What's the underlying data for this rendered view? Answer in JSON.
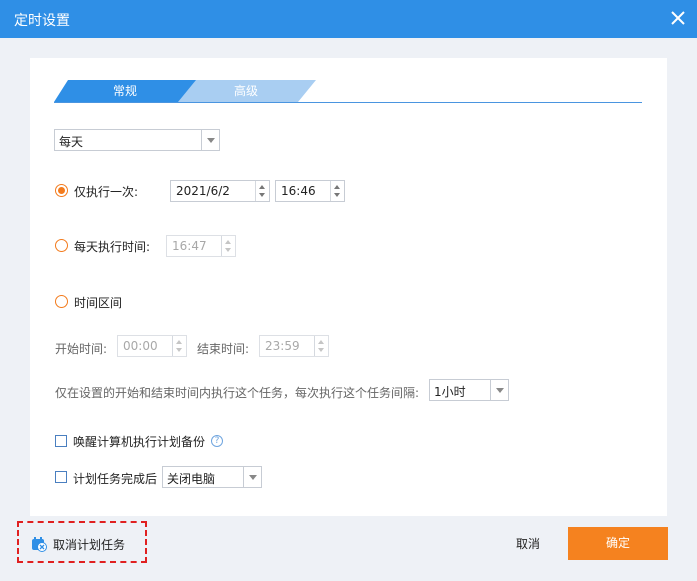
{
  "window": {
    "title": "定时设置"
  },
  "tabs": [
    {
      "label": "常规",
      "active": true
    },
    {
      "label": "高级",
      "active": false
    }
  ],
  "frequency": {
    "value": "每天"
  },
  "once": {
    "label": "仅执行一次:",
    "date": "2021/6/2",
    "time": "16:46",
    "checked": true
  },
  "daily": {
    "label": "每天执行时间:",
    "time": "16:47"
  },
  "interval": {
    "label": "时间区间",
    "start_label": "开始时间:",
    "start": "00:00",
    "end_label": "结束时间:",
    "end": "23:59",
    "note": "仅在设置的开始和结束时间内执行这个任务，每次执行这个任务间隔:",
    "every": "1小时"
  },
  "wake": {
    "label": "唤醒计算机执行计划备份",
    "help_icon": "?"
  },
  "after": {
    "label": "计划任务完成后",
    "action": "关闭电脑"
  },
  "footer": {
    "cancel_plan": "取消计划任务",
    "cancel": "取消",
    "ok": "确定"
  },
  "colors": {
    "titlebar": "#2f8fe6",
    "accent": "#f5821f",
    "tab_active": "#2f8fe6",
    "tab_inactive": "#a9cef2",
    "radio": "#f37b1d"
  },
  "icons": {
    "close": "close-icon",
    "cancel_plan": "calendar-cancel-icon"
  }
}
